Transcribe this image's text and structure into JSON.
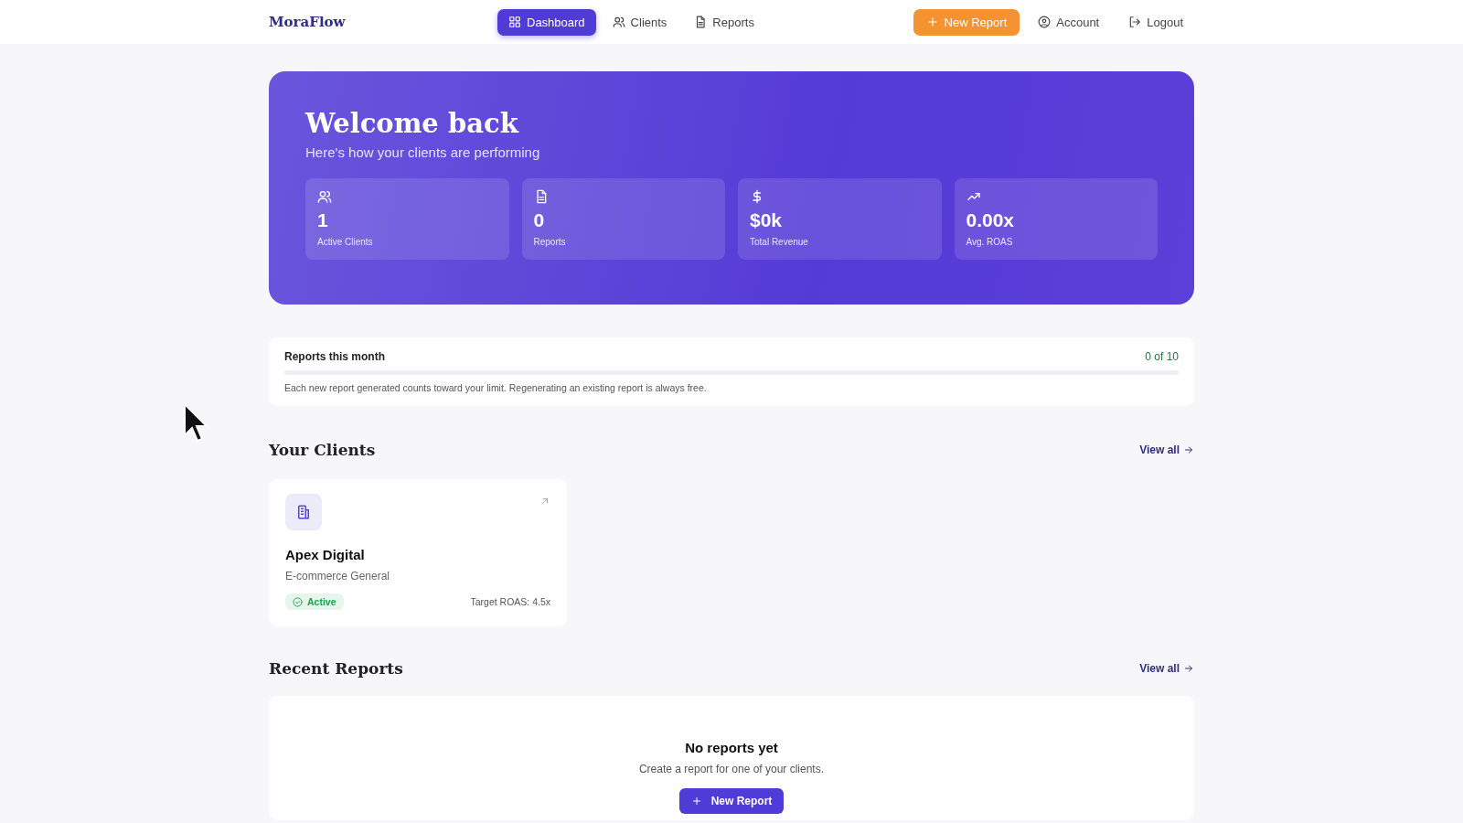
{
  "brand": "MoraFlow",
  "nav": [
    {
      "label": "Dashboard",
      "kind": "dashboard",
      "selected": true
    },
    {
      "label": "Clients",
      "kind": "clients",
      "selected": false
    },
    {
      "label": "Reports",
      "kind": "reports",
      "selected": false
    }
  ],
  "actions": [
    {
      "label": "New Report",
      "kind": "create"
    },
    {
      "label": "Account",
      "kind": "account"
    },
    {
      "label": "Logout",
      "kind": "logout"
    }
  ],
  "hero": {
    "title": "Welcome back",
    "subtitle": "Here's how your clients are performing",
    "stats": [
      {
        "kind": "clients",
        "value": "1",
        "label": "Active Clients"
      },
      {
        "kind": "reports",
        "value": "0",
        "label": "Reports"
      },
      {
        "kind": "revenue",
        "value": "$0k",
        "label": "Total Revenue"
      },
      {
        "kind": "roas",
        "value": "0.00x",
        "label": "Avg. ROAS"
      }
    ]
  },
  "usage": {
    "title": "Reports this month",
    "count": "0 of 10",
    "level": 0,
    "note": "Each new report generated counts toward your limit. Regenerating an existing report is always free."
  },
  "clients": {
    "title": "Your Clients",
    "link": "View all",
    "items": [
      {
        "name": "Apex Digital",
        "category": "E-commerce General",
        "status": "Active",
        "color": "#16a34a",
        "target": "Target ROAS: 4.5x"
      }
    ]
  },
  "reports": {
    "title": "Recent Reports",
    "link": "View all",
    "empty_title": "No reports yet",
    "empty_text": "Create a report for one of your clients.",
    "button": "New Report"
  }
}
